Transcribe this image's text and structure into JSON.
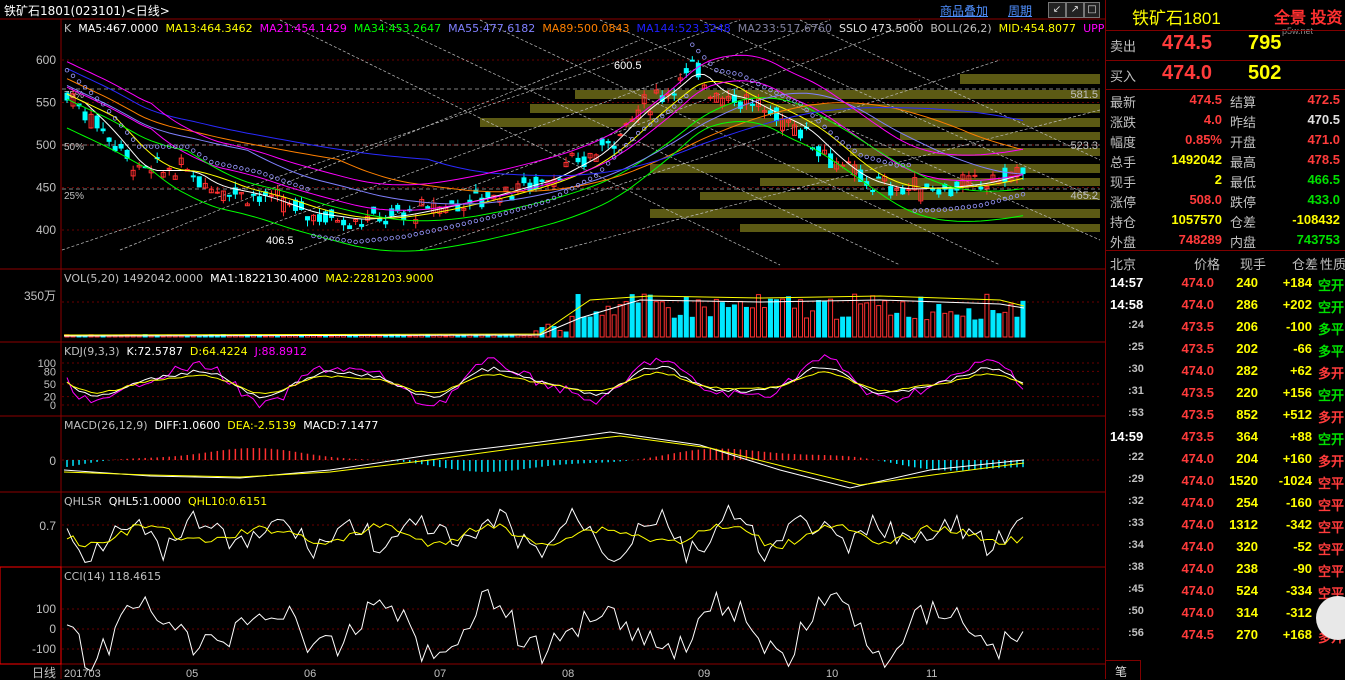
{
  "header": {
    "title": "铁矿石1801(023101)<日线>",
    "links": [
      "商品叠加",
      "周期"
    ],
    "window_buttons": [
      "↙",
      "↗",
      "□",
      "✕"
    ]
  },
  "main_panel": {
    "ma_legend": [
      {
        "text": "K",
        "color": "#c0c0c0"
      },
      {
        "text": "MA5:467.0000",
        "color": "#ffffff"
      },
      {
        "text": "MA13:464.3462",
        "color": "#ffff00"
      },
      {
        "text": "MA21:454.1429",
        "color": "#ff00ff"
      },
      {
        "text": "MA34:453.2647",
        "color": "#00ff00"
      },
      {
        "text": "MA55:477.6182",
        "color": "#8080ff"
      },
      {
        "text": "MA89:500.0843",
        "color": "#ff8000"
      },
      {
        "text": "MA144:523.3248",
        "color": "#2020ff"
      },
      {
        "text": "MA233:517.6760",
        "color": "#8080a0"
      },
      {
        "text": "SSLO 473.5000",
        "color": "#e0e0e0"
      },
      {
        "text": "BOLL(26,2)",
        "color": "#c0c0c0"
      },
      {
        "text": "MID:454.8077",
        "color": "#ffff00"
      },
      {
        "text": "UPPER",
        "color": "#ff00ff"
      }
    ],
    "y_ticks": [
      "600",
      "550",
      "500",
      "450",
      "400"
    ],
    "pct_labels": [
      "75%",
      "50%",
      "25%"
    ],
    "right_labels": [
      "581.5",
      "523.3",
      "465.2"
    ],
    "annotations": [
      "600.5",
      "406.5"
    ],
    "colors": {
      "up": "#ff3030",
      "down": "#00ffff"
    }
  },
  "vol_panel": {
    "legend": [
      {
        "text": "VOL(5,20) 1492042.0000",
        "color": "#c0c0c0"
      },
      {
        "text": "MA1:1822130.4000",
        "color": "#ffffff"
      },
      {
        "text": "MA2:2281203.9000",
        "color": "#ffff00"
      }
    ],
    "y_label": "350万"
  },
  "kdj_panel": {
    "legend": [
      {
        "text": "KDJ(9,3,3)",
        "color": "#c0c0c0"
      },
      {
        "text": "K:72.5787",
        "color": "#ffffff"
      },
      {
        "text": "D:64.4224",
        "color": "#ffff00"
      },
      {
        "text": "J:88.8912",
        "color": "#ff00ff"
      }
    ],
    "y_ticks": [
      "100",
      "80",
      "50",
      "20",
      "0"
    ]
  },
  "macd_panel": {
    "legend": [
      {
        "text": "MACD(26,12,9)",
        "color": "#c0c0c0"
      },
      {
        "text": "DIFF:1.0600",
        "color": "#ffffff"
      },
      {
        "text": "DEA:-2.5139",
        "color": "#ffff00"
      },
      {
        "text": "MACD:7.1477",
        "color": "#ffffff"
      }
    ],
    "y_ticks": [
      "0"
    ]
  },
  "qhlsr_panel": {
    "legend": [
      {
        "text": "QHLSR",
        "color": "#c0c0c0"
      },
      {
        "text": "QHL5:1.0000",
        "color": "#ffffff"
      },
      {
        "text": "QHL10:0.6151",
        "color": "#ffff00"
      }
    ],
    "y_ticks": [
      "0.7"
    ]
  },
  "cci_panel": {
    "legend": [
      {
        "text": "CCI(14) 118.4615",
        "color": "#c0c0c0"
      }
    ],
    "y_ticks": [
      "100",
      "0",
      "-100"
    ]
  },
  "x_axis": {
    "first": "日线",
    "labels": [
      "201703",
      "05",
      "06",
      "07",
      "08",
      "09",
      "10",
      "11"
    ]
  },
  "side": {
    "title": "铁矿石1801",
    "logo": "全景 投资",
    "logo_sub": "p5w.net",
    "sell": {
      "label": "卖出",
      "price": "474.5",
      "volume": "795"
    },
    "buy": {
      "label": "买入",
      "price": "474.0",
      "volume": "502"
    },
    "stats": [
      {
        "l1": "最新",
        "v1": "474.5",
        "c1": "red",
        "l2": "结算",
        "v2": "472.5",
        "c2": "red"
      },
      {
        "l1": "涨跌",
        "v1": "4.0",
        "c1": "red",
        "l2": "昨结",
        "v2": "470.5",
        "c2": "wht"
      },
      {
        "l1": "幅度",
        "v1": "0.85%",
        "c1": "red",
        "l2": "开盘",
        "v2": "471.0",
        "c2": "red"
      },
      {
        "l1": "总手",
        "v1": "1492042",
        "c1": "yel",
        "l2": "最高",
        "v2": "478.5",
        "c2": "red"
      },
      {
        "l1": "现手",
        "v1": "2",
        "c1": "yel",
        "l2": "最低",
        "v2": "466.5",
        "c2": "grn"
      },
      {
        "l1": "涨停",
        "v1": "508.0",
        "c1": "red",
        "l2": "跌停",
        "v2": "433.0",
        "c2": "grn"
      },
      {
        "l1": "持仓",
        "v1": "1057570",
        "c1": "yel",
        "l2": "仓差",
        "v2": "-108432",
        "c2": "yel"
      },
      {
        "l1": "外盘",
        "v1": "748289",
        "c1": "red",
        "l2": "内盘",
        "v2": "743753",
        "c2": "grn"
      }
    ],
    "tape_header": [
      "北京",
      "价格",
      "现手",
      "仓差",
      "性质"
    ],
    "tape": [
      {
        "t": "14:57",
        "p": "474.0",
        "pc": "red",
        "v": "240",
        "d": "+184",
        "n": "空开",
        "nc": "grn"
      },
      {
        "t": "14:58",
        "p": "474.0",
        "pc": "red",
        "v": "286",
        "d": "+202",
        "n": "空开",
        "nc": "grn"
      },
      {
        "t": ":24",
        "p": "473.5",
        "pc": "red",
        "v": "206",
        "d": "-100",
        "n": "多平",
        "nc": "grn"
      },
      {
        "t": ":25",
        "p": "473.5",
        "pc": "red",
        "v": "202",
        "d": "-66",
        "n": "多平",
        "nc": "grn"
      },
      {
        "t": ":30",
        "p": "474.0",
        "pc": "red",
        "v": "282",
        "d": "+62",
        "n": "多开",
        "nc": "red"
      },
      {
        "t": ":31",
        "p": "473.5",
        "pc": "red",
        "v": "220",
        "d": "+156",
        "n": "空开",
        "nc": "grn"
      },
      {
        "t": ":53",
        "p": "473.5",
        "pc": "red",
        "v": "852",
        "d": "+512",
        "n": "多开",
        "nc": "red"
      },
      {
        "t": "14:59",
        "p": "473.5",
        "pc": "red",
        "v": "364",
        "d": "+88",
        "n": "空开",
        "nc": "grn"
      },
      {
        "t": ":22",
        "p": "474.0",
        "pc": "red",
        "v": "204",
        "d": "+160",
        "n": "多开",
        "nc": "red"
      },
      {
        "t": ":29",
        "p": "474.0",
        "pc": "red",
        "v": "1520",
        "d": "-1024",
        "n": "空平",
        "nc": "red"
      },
      {
        "t": ":32",
        "p": "474.0",
        "pc": "red",
        "v": "254",
        "d": "-160",
        "n": "空平",
        "nc": "red"
      },
      {
        "t": ":33",
        "p": "474.0",
        "pc": "red",
        "v": "1312",
        "d": "-342",
        "n": "空平",
        "nc": "red"
      },
      {
        "t": ":34",
        "p": "474.0",
        "pc": "red",
        "v": "320",
        "d": "-52",
        "n": "空平",
        "nc": "red"
      },
      {
        "t": ":38",
        "p": "474.0",
        "pc": "red",
        "v": "238",
        "d": "-90",
        "n": "空平",
        "nc": "red"
      },
      {
        "t": ":45",
        "p": "474.0",
        "pc": "red",
        "v": "524",
        "d": "-334",
        "n": "空平",
        "nc": "red"
      },
      {
        "t": ":50",
        "p": "474.0",
        "pc": "red",
        "v": "314",
        "d": "-312",
        "n": "多平",
        "nc": "grn"
      },
      {
        "t": ":56",
        "p": "474.5",
        "pc": "red",
        "v": "270",
        "d": "+168",
        "n": "多开",
        "nc": "red"
      }
    ],
    "bottom_tab": "笔"
  }
}
